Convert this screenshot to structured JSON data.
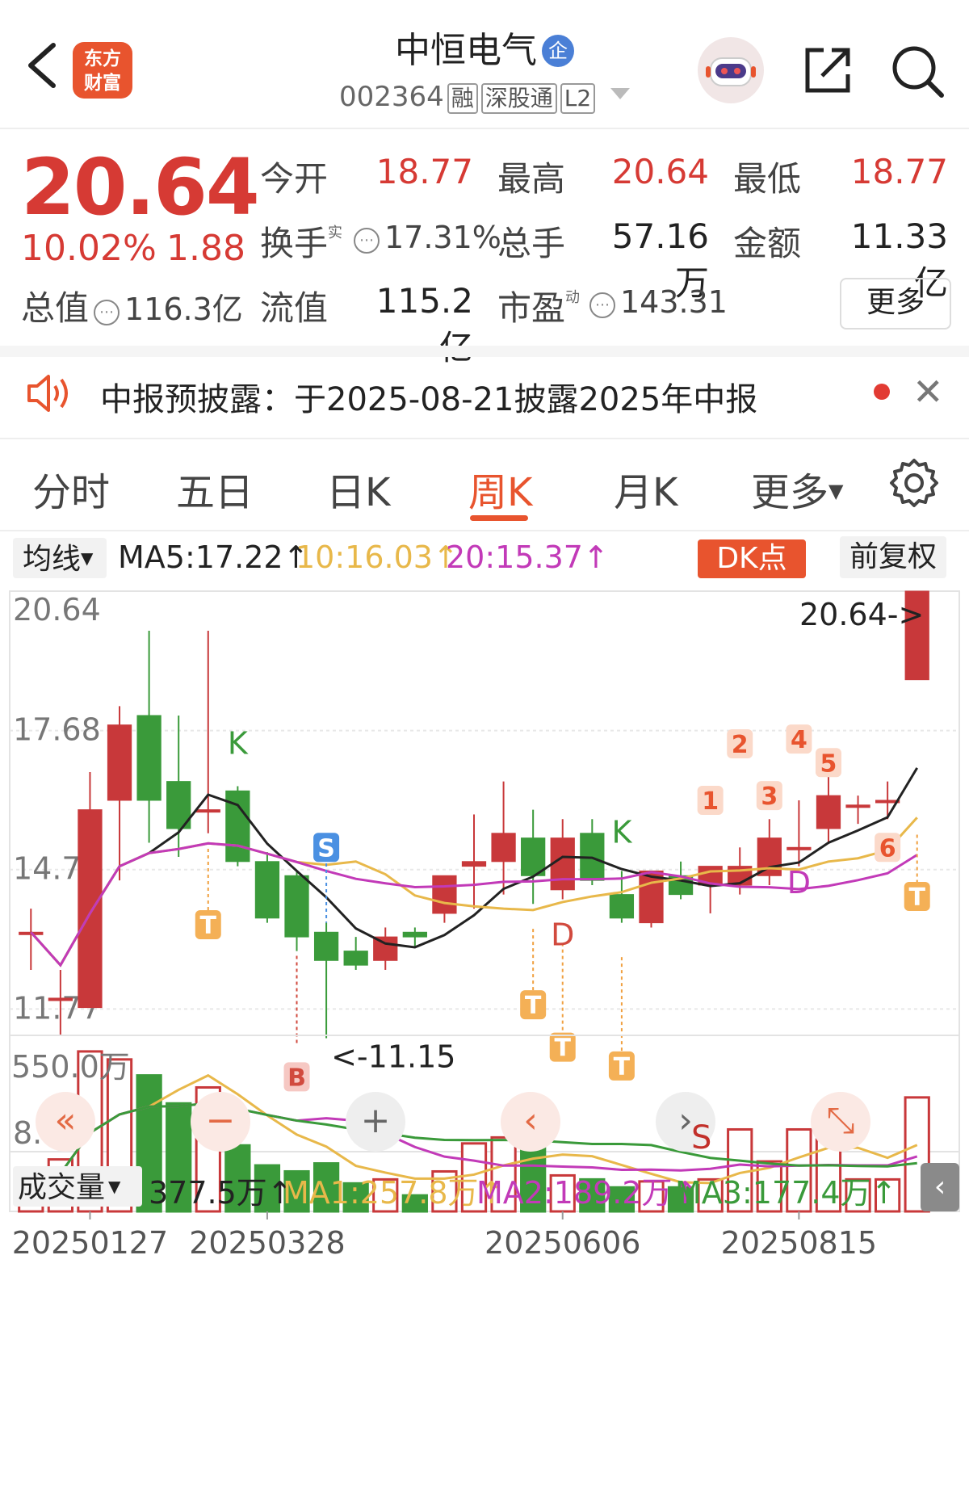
{
  "header": {
    "stock_name": "中恒电气",
    "badge": "企",
    "code": "002364",
    "tags": [
      "融",
      "深股通",
      "L2"
    ],
    "logo_text_line1": "东方",
    "logo_text_line2": "财富"
  },
  "quote": {
    "price": "20.64",
    "change_pct": "10.02%",
    "change": "1.88",
    "open_label": "今开",
    "open": "18.77",
    "high_label": "最高",
    "high": "20.64",
    "low_label": "最低",
    "low": "18.77",
    "turnover_label": "换手",
    "turnover_sup": "实",
    "turnover": "17.31%",
    "volume_label": "总手",
    "volume": "57.16万",
    "amount_label": "金额",
    "amount": "11.33亿",
    "mcap_label": "总值",
    "mcap": "116.3亿",
    "float_label": "流值",
    "float": "115.2亿",
    "pe_label": "市盈",
    "pe_sup": "动",
    "pe": "143.31",
    "more": "更多"
  },
  "notice": {
    "text": "中报预披露：于2025-08-21披露2025年中报"
  },
  "tabs": [
    "分时",
    "五日",
    "日K",
    "周K",
    "月K",
    "更多"
  ],
  "active_tab": "周K",
  "ma_bar": {
    "selector": "均线",
    "ma5": "MA5:17.22↑",
    "ma10": "10:16.03↑",
    "ma20": "20:15.37↑",
    "dk": "DK点",
    "adjust": "前复权",
    "colors": {
      "ma5": "#222222",
      "ma10": "#e8b84a",
      "ma20": "#c23ab8"
    }
  },
  "vol_bar": {
    "selector": "成交量",
    "vol": "377.5万↑",
    "ma1": "MA1:257.8万↑",
    "ma2": "MA2:189.2万↑",
    "ma3": "MA3:177.4万↑",
    "colors": {
      "ma1": "#e8b84a",
      "ma2": "#c23ab8",
      "ma3": "#3a9a3a"
    }
  },
  "chart_data": {
    "type": "candlestick",
    "y_ticks": [
      "20.64",
      "17.68",
      "14.73",
      "11.77",
      "8.81"
    ],
    "ylim": [
      8.81,
      20.64
    ],
    "max_label": "20.64->",
    "min_label": "<-11.15",
    "x_labels": [
      "20250127",
      "20250328",
      "20250606",
      "20250815"
    ],
    "candles": [
      {
        "o": 13.4,
        "h": 13.9,
        "l": 12.6,
        "c": 13.4
      },
      {
        "o": 12.0,
        "h": 12.6,
        "l": 11.2,
        "c": 12.0
      },
      {
        "o": 11.8,
        "h": 16.8,
        "l": 11.8,
        "c": 16.0
      },
      {
        "o": 16.2,
        "h": 18.2,
        "l": 14.5,
        "c": 17.8
      },
      {
        "o": 18.0,
        "h": 19.8,
        "l": 15.3,
        "c": 16.2
      },
      {
        "o": 16.6,
        "h": 18.0,
        "l": 15.0,
        "c": 15.6
      },
      {
        "o": 16.0,
        "h": 19.8,
        "l": 15.5,
        "c": 16.0
      },
      {
        "o": 16.4,
        "h": 16.5,
        "l": 14.8,
        "c": 14.9
      },
      {
        "o": 14.9,
        "h": 15.1,
        "l": 13.6,
        "c": 13.7
      },
      {
        "o": 14.6,
        "h": 14.7,
        "l": 13.0,
        "c": 13.3
      },
      {
        "o": 13.4,
        "h": 13.6,
        "l": 11.15,
        "c": 12.8
      },
      {
        "o": 13.0,
        "h": 13.3,
        "l": 12.6,
        "c": 12.7
      },
      {
        "o": 12.8,
        "h": 13.5,
        "l": 12.6,
        "c": 13.3
      },
      {
        "o": 13.4,
        "h": 13.5,
        "l": 13.1,
        "c": 13.3
      },
      {
        "o": 13.8,
        "h": 14.5,
        "l": 13.6,
        "c": 14.6
      },
      {
        "o": 14.8,
        "h": 15.9,
        "l": 13.9,
        "c": 14.9
      },
      {
        "o": 14.9,
        "h": 16.6,
        "l": 14.2,
        "c": 15.5
      },
      {
        "o": 15.4,
        "h": 16.0,
        "l": 14.0,
        "c": 14.6
      },
      {
        "o": 14.3,
        "h": 15.8,
        "l": 14.1,
        "c": 15.4
      },
      {
        "o": 15.5,
        "h": 15.8,
        "l": 14.4,
        "c": 14.5
      },
      {
        "o": 14.2,
        "h": 14.7,
        "l": 13.6,
        "c": 13.7
      },
      {
        "o": 13.6,
        "h": 14.7,
        "l": 13.5,
        "c": 14.7
      },
      {
        "o": 14.6,
        "h": 14.9,
        "l": 14.1,
        "c": 14.2
      },
      {
        "o": 14.4,
        "h": 14.8,
        "l": 13.8,
        "c": 14.8
      },
      {
        "o": 14.4,
        "h": 15.2,
        "l": 14.2,
        "c": 14.8
      },
      {
        "o": 14.6,
        "h": 15.8,
        "l": 14.4,
        "c": 15.4
      },
      {
        "o": 15.2,
        "h": 16.2,
        "l": 14.8,
        "c": 15.2
      },
      {
        "o": 15.6,
        "h": 16.8,
        "l": 15.3,
        "c": 16.3
      },
      {
        "o": 16.1,
        "h": 16.3,
        "l": 15.7,
        "c": 16.1
      },
      {
        "o": 16.2,
        "h": 16.6,
        "l": 15.8,
        "c": 16.2
      },
      {
        "o": 18.76,
        "h": 20.64,
        "l": 18.76,
        "c": 20.64
      }
    ],
    "volume": [
      60,
      130,
      400,
      380,
      340,
      270,
      310,
      165,
      115,
      100,
      120,
      70,
      80,
      40,
      100,
      170,
      185,
      165,
      90,
      80,
      60,
      75,
      60,
      80,
      205,
      125,
      205,
      180,
      80,
      80,
      285
    ],
    "vol_max_label": "550.0万",
    "markers": [
      "K",
      "S",
      "B",
      "T",
      "D",
      "1",
      "2",
      "3",
      "4",
      "5",
      "6"
    ],
    "controls": [
      "«",
      "−",
      "+",
      "‹",
      "›",
      "⤡"
    ]
  }
}
